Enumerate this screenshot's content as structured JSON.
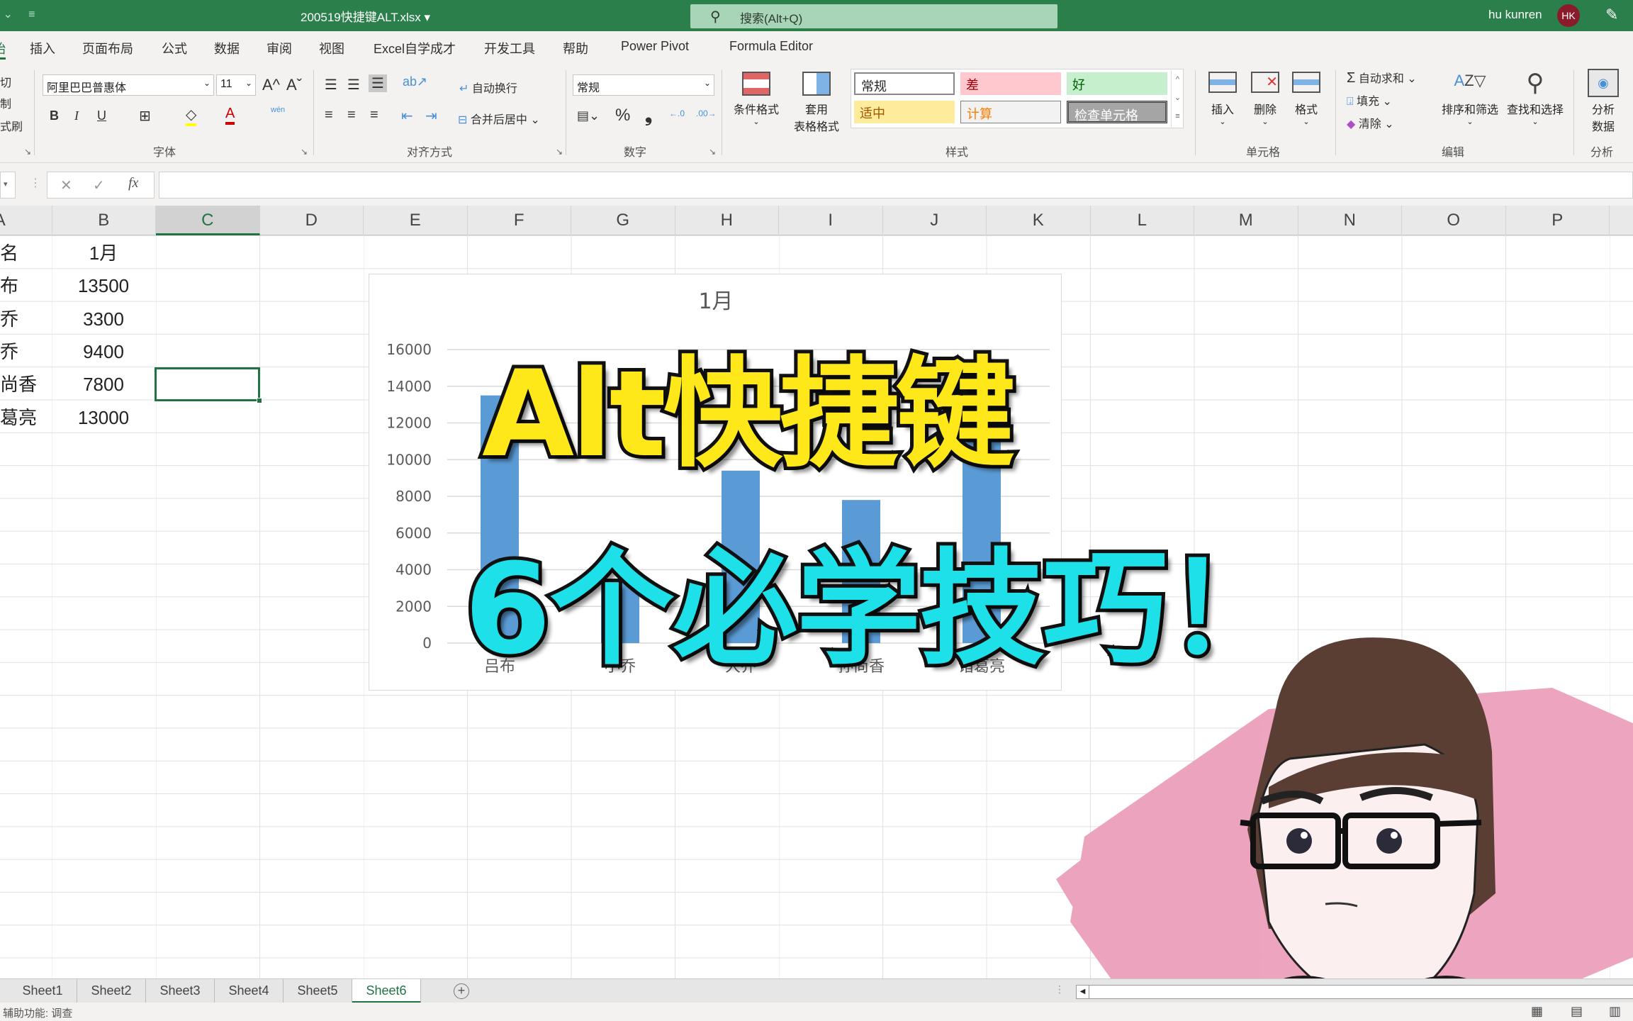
{
  "titlebar": {
    "qat_icon": "customize-qat-icon",
    "file_name": "200519快捷键ALT.xlsx",
    "file_dropdown": "▾",
    "search_placeholder": "搜索(Alt+Q)",
    "user_name": "hu kunren",
    "user_initials": "HK",
    "accent": "#2a7f4a",
    "avatar_color": "#8b1a2a"
  },
  "menu": {
    "items": [
      "插入",
      "页面布局",
      "公式",
      "数据",
      "审阅",
      "视图",
      "Excel自学成才",
      "开发工具",
      "帮助",
      "Power Pivot",
      "Formula Editor"
    ],
    "active_partial": "始"
  },
  "ribbon": {
    "clipboard": {
      "format_painter_partial": "式刷",
      "cut_partial": "切",
      "copy_partial": "制"
    },
    "font": {
      "font_name": "阿里巴巴普惠体",
      "font_size": "11",
      "grow": "A^",
      "shrink": "Aˇ",
      "bold": "B",
      "italic": "I",
      "underline": "U",
      "phonetic": "wén",
      "group_label": "字体"
    },
    "alignment": {
      "wrap_text": "自动换行",
      "merge_center": "合并后居中",
      "group_label": "对齐方式"
    },
    "number": {
      "format": "常规",
      "percent": "%",
      "comma": "❟",
      "inc_decimal": "←.0",
      "dec_decimal": ".00→",
      "group_label": "数字"
    },
    "styles": {
      "conditional_format": "条件格式",
      "table_format_1": "套用",
      "table_format_2": "表格格式",
      "cells": [
        {
          "label": "常规",
          "bg": "#ffffff",
          "fg": "#222222"
        },
        {
          "label": "差",
          "bg": "#ffc7ce",
          "fg": "#9c0006"
        },
        {
          "label": "好",
          "bg": "#c6efce",
          "fg": "#006100"
        },
        {
          "label": "适中",
          "bg": "#ffeb9c",
          "fg": "#9c5700"
        },
        {
          "label": "计算",
          "bg": "#f2f2f2",
          "fg": "#fa7d00"
        },
        {
          "label": "检查单元格",
          "bg": "#a5a5a5",
          "fg": "#ffffff"
        }
      ],
      "group_label": "样式"
    },
    "cells": {
      "insert": "插入",
      "delete": "删除",
      "format": "格式",
      "group_label": "单元格"
    },
    "editing": {
      "autosum": "自动求和",
      "fill": "填充",
      "clear": "清除",
      "sort_filter": "排序和筛选",
      "find_select": "查找和选择",
      "group_label": "编辑"
    },
    "analysis": {
      "analyze_1": "分析",
      "analyze_2": "数据",
      "group_label": "分析"
    }
  },
  "formula_bar": {
    "cancel": "✕",
    "enter": "✓",
    "fx": "fx",
    "value": ""
  },
  "columns": [
    "A",
    "B",
    "C",
    "D",
    "E",
    "F",
    "G",
    "H",
    "I",
    "J",
    "K",
    "L",
    "M",
    "N",
    "O",
    "P"
  ],
  "selected_column": "C",
  "sheet": {
    "rows": [
      {
        "a": "名",
        "b": "1月"
      },
      {
        "a": "布",
        "b": "13500"
      },
      {
        "a": "乔",
        "b": "3300"
      },
      {
        "a": "乔",
        "b": "9400"
      },
      {
        "a": "尚香",
        "b": "7800"
      },
      {
        "a": "葛亮",
        "b": "13000"
      }
    ]
  },
  "chart_data": {
    "type": "bar",
    "title": "1月",
    "categories": [
      "吕布",
      "小乔",
      "大乔",
      "孙尚香",
      "诸葛亮"
    ],
    "values": [
      13500,
      3300,
      9400,
      7800,
      13000
    ],
    "yticks": [
      "0",
      "2000",
      "4000",
      "6000",
      "8000",
      "10000",
      "12000",
      "14000",
      "16000"
    ],
    "ylim": [
      0,
      16000
    ],
    "xlabel": "",
    "ylabel": "",
    "grid": true,
    "bar_color": "#5b9bd5"
  },
  "overlay": {
    "line1": "Alt快捷键",
    "line2": "6个必学技巧！",
    "line1_color": "#ffe81a",
    "line2_color": "#1ee0e8"
  },
  "tabs": {
    "sheets": [
      "Sheet1",
      "Sheet2",
      "Sheet3",
      "Sheet4",
      "Sheet5",
      "Sheet6"
    ],
    "active": "Sheet6",
    "add": "+"
  },
  "status": {
    "accessibility": "辅助功能: 调查"
  }
}
